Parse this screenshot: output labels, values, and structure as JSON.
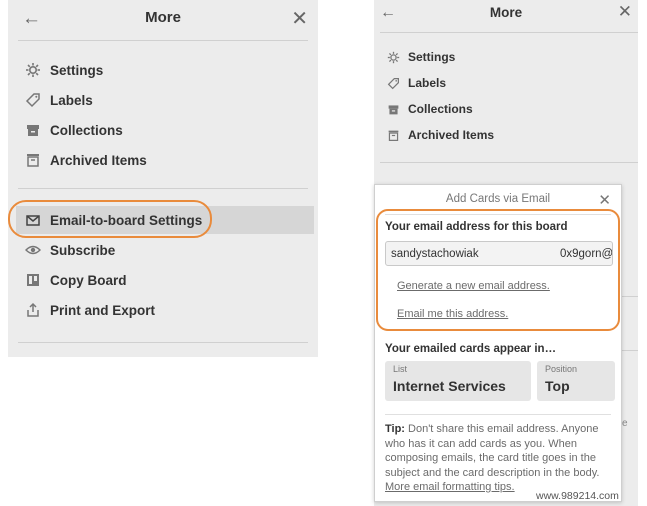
{
  "left_panel": {
    "back_icon": "arrow-left-icon",
    "title": "More",
    "close_icon": "close-icon",
    "menu": [
      {
        "icon": "gear-icon",
        "label": "Settings"
      },
      {
        "icon": "tag-icon",
        "label": "Labels"
      },
      {
        "icon": "archive-box-icon",
        "label": "Collections"
      },
      {
        "icon": "archive-tray-icon",
        "label": "Archived Items"
      }
    ],
    "menu2": [
      {
        "icon": "envelope-icon",
        "label": "Email-to-board Settings",
        "highlighted": true
      },
      {
        "icon": "eye-icon",
        "label": "Subscribe"
      },
      {
        "icon": "board-icon",
        "label": "Copy Board"
      },
      {
        "icon": "share-icon",
        "label": "Print and Export"
      }
    ]
  },
  "right_panel": {
    "back_icon": "arrow-left-icon",
    "title": "More",
    "close_icon": "close-icon",
    "menu": [
      {
        "icon": "gear-icon",
        "label": "Settings"
      },
      {
        "icon": "tag-icon",
        "label": "Labels"
      },
      {
        "icon": "archive-box-icon",
        "label": "Collections"
      },
      {
        "icon": "archive-tray-icon",
        "label": "Archived Items"
      }
    ]
  },
  "popover": {
    "title": "Add Cards via Email",
    "close_icon": "close-icon",
    "email_label": "Your email address for this board",
    "email_value_user": "sandystachowiak",
    "email_value_suffix": "0x9gorn@",
    "generate_link": "Generate a new email address.",
    "email_me_link": "Email me this address.",
    "appear_label": "Your emailed cards appear in…",
    "list_caption": "List",
    "list_value": "Internet Services",
    "position_caption": "Position",
    "position_value": "Top",
    "tip_bold": "Tip:",
    "tip_text": " Don't share this email address. Anyone who has it can add cards as you. When composing emails, the card title goes in the subject and the card description in the body. ",
    "tip_link": "More email formatting tips."
  },
  "edge_fragment": "e",
  "watermark": "www.989214.com",
  "colors": {
    "highlight_ring": "#e98b3c",
    "panel_bg": "#ececec"
  }
}
